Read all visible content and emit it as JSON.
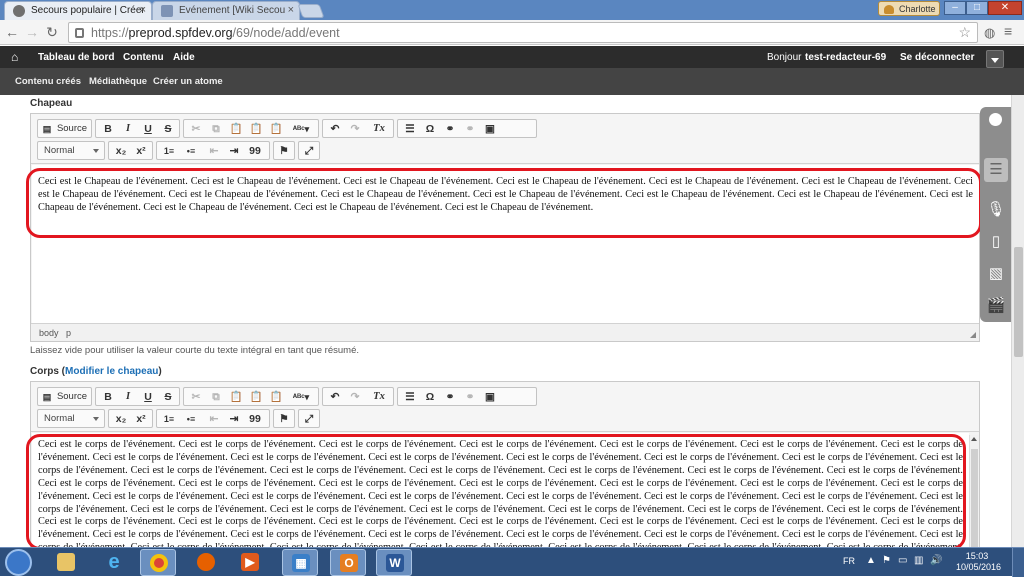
{
  "browser": {
    "tabs": [
      {
        "title": "Secours populaire | Créer",
        "active": true
      },
      {
        "title": "Evénement [Wiki Secou",
        "active": false
      }
    ],
    "user_name": "Charlotte",
    "url_scheme": "https://",
    "url_host": "preprod.spfdev.org",
    "url_path": "/69/node/add/event"
  },
  "admin_bar": {
    "home_icon": "home-icon",
    "items": [
      "Tableau de bord",
      "Contenu",
      "Aide"
    ],
    "greeting_prefix": "Bonjour",
    "user": "test-redacteur-69",
    "logout": "Se déconnecter"
  },
  "sub_bar": {
    "items": [
      "Contenu créés",
      "Médiathèque",
      "Créer un atome"
    ]
  },
  "chapeau_field": {
    "label": "Chapeau",
    "path_body": "body",
    "path_p": "p",
    "description": "Laissez vide pour utiliser la valeur courte du texte intégral en tant que résumé.",
    "content": "Ceci est le Chapeau de l'événement. Ceci est le Chapeau de l'événement. Ceci est le Chapeau de l'événement. Ceci est le Chapeau de l'événement. Ceci est le Chapeau de l'événement. Ceci est le Chapeau de l'événement. Ceci est le Chapeau de l'événement. Ceci est le Chapeau de l'événement. Ceci est le Chapeau de l'événement. Ceci est le Chapeau de l'événement. Ceci est le Chapeau de l'événement. Ceci est le Chapeau de l'événement. Ceci est le Chapeau de l'événement. Ceci est le Chapeau de l'événement. Ceci est le Chapeau de l'événement. Ceci est le Chapeau de l'événement."
  },
  "corps_field": {
    "label": "Corps",
    "open_paren": " (",
    "link": "Modifier le chapeau",
    "close_paren": ")",
    "content": "Ceci est le corps de l'événement. Ceci est le corps de l'événement. Ceci est le corps de l'événement. Ceci est le corps de l'événement. Ceci est le corps de l'événement. Ceci est le corps de l'événement. Ceci est le corps de l'événement. Ceci est le corps de l'événement. Ceci est le corps de l'événement. Ceci est le corps de l'événement. Ceci est le corps de l'événement. Ceci est le corps de l'événement. Ceci est le corps de l'événement. Ceci est le corps de l'événement. Ceci est le corps de l'événement. Ceci est le corps de l'événement. Ceci est le corps de l'événement. Ceci est le corps de l'événement. Ceci est le corps de l'événement. Ceci est le corps de l'événement. Ceci est le corps de l'événement. Ceci est le corps de l'événement. Ceci est le corps de l'événement. Ceci est le corps de l'événement. Ceci est le corps de l'événement. Ceci est le corps de l'événement. Ceci est le corps de l'événement. Ceci est le corps de l'événement. Ceci est le corps de l'événement. Ceci est le corps de l'événement. Ceci est le corps de l'événement. Ceci est le corps de l'événement. Ceci est le corps de l'événement. Ceci est le corps de l'événement. Ceci est le corps de l'événement. Ceci est le corps de l'événement. Ceci est le corps de l'événement. Ceci est le corps de l'événement. Ceci est le corps de l'événement. Ceci est le corps de l'événement. Ceci est le corps de l'événement. Ceci est le corps de l'événement. Ceci est le corps de l'événement. Ceci est le corps de l'événement. Ceci est le corps de l'événement. Ceci est le corps de l'événement. Ceci est le corps de l'événement. Ceci est le corps de l'événement. Ceci est le corps de l'événement. Ceci est le corps de l'événement. Ceci est le corps de l'événement. Ceci est le corps de l'événement. Ceci est le corps de l'événement. Ceci est le corps de l'événement. Ceci est le corps de l'événement. Ceci est le corps de l'événement. Ceci est le corps de l'événement. Ceci est le corps de l'événement. Ceci est le corps de l'événement. Ceci est le corps de l'événement. Ceci est le corps de l'événement. Ceci est le corps de l'événement. Ceci est le corps de l'événement. Ceci est le corps de l'événement. Ceci est le corps de l'événement. Ceci est le corps de l'événement. Ceci est le corps de l'événement. Ceci est le corps de l'événement. Ceci est le corps de l'événement. Ceci est le corps de l'événement."
  },
  "ck_toolbar": {
    "source": "Source",
    "bold": "B",
    "italic": "I",
    "underline": "U",
    "strike": "S",
    "omega": "Ω",
    "numbered": "1≡",
    "bulleted": "•≡",
    "blockquote": "99",
    "format": "Normal",
    "subscript": "x₂",
    "superscript": "x²",
    "remove_format": "Tx"
  },
  "taskbar": {
    "lang": "FR",
    "time": "15:03",
    "date": "10/05/2016",
    "apps": [
      "explorer-icon",
      "ie-icon",
      "chrome-icon",
      "firefox-icon",
      "media-player-icon",
      "calendar-icon",
      "outlook-icon",
      "word-icon"
    ]
  },
  "colors": {
    "highlight": "#e2161f",
    "admin_bar": "#2c2c2c",
    "link": "#1d6fb5"
  }
}
